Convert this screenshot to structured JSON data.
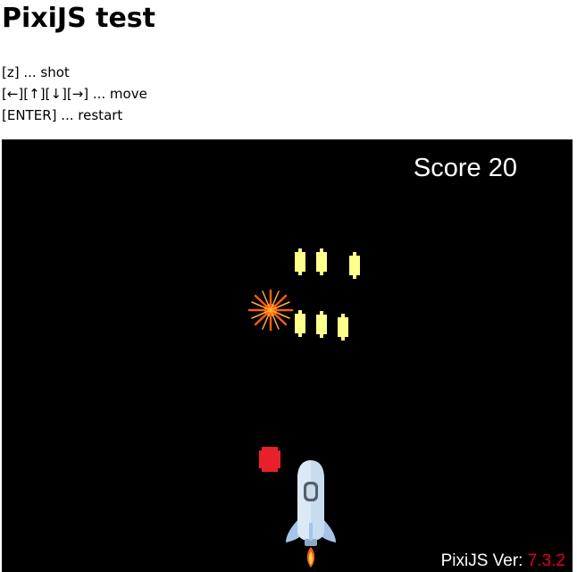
{
  "page": {
    "title": "PixiJS test"
  },
  "instructions": [
    "[z] ... shot",
    "[←][↑][↓][→] ... move",
    "[ENTER] ... restart"
  ],
  "game": {
    "score_label": "Score",
    "score_value": "20",
    "version_label": "PixiJS Ver:",
    "version_number": "7.3.2",
    "colors": {
      "background": "#000000",
      "enemy": "#ffff8c",
      "enemy_bullet": "#e8202a",
      "version_number": "#e0001a"
    }
  }
}
